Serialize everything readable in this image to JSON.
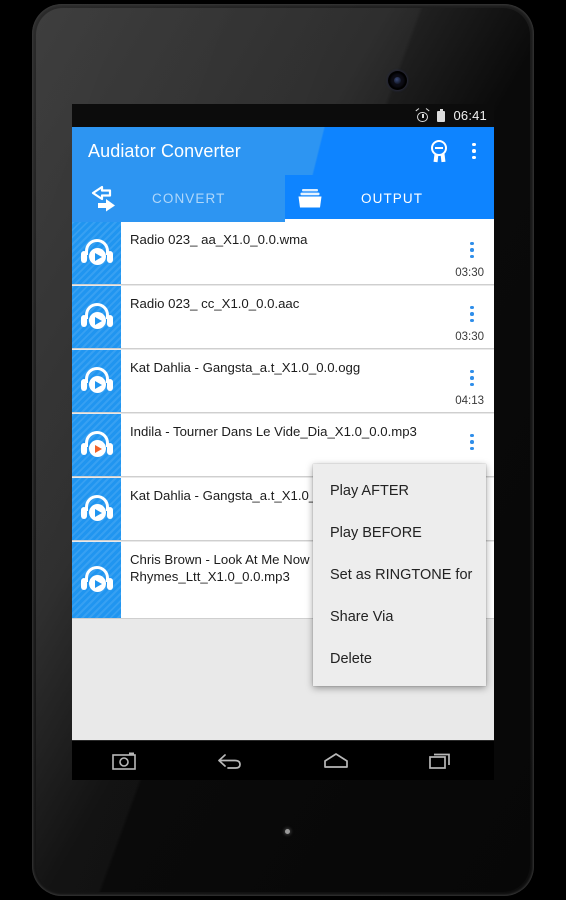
{
  "status_bar": {
    "alarm_icon": "alarm-clock-icon",
    "battery_icon": "battery-icon",
    "time": "06:41"
  },
  "app_bar": {
    "title": "Audiator Converter",
    "award_icon": "award-badge-icon",
    "overflow_icon": "overflow-menu-icon"
  },
  "tabs": [
    {
      "label": "CONVERT",
      "icon": "convert-arrows-icon",
      "active": false
    },
    {
      "label": "OUTPUT",
      "icon": "folder-icon",
      "active": true
    }
  ],
  "list": {
    "items": [
      {
        "title": "Radio 023_ aa_X1.0_0.0.wma",
        "duration": "03:30",
        "icon": "headphones-play-icon",
        "playing": false
      },
      {
        "title": "Radio 023_ cc_X1.0_0.0.aac",
        "duration": "03:30",
        "icon": "headphones-play-icon",
        "playing": false
      },
      {
        "title": "Kat Dahlia - Gangsta_a.t_X1.0_0.0.ogg",
        "duration": "04:13",
        "icon": "headphones-play-icon",
        "playing": false
      },
      {
        "title": "Indila - Tourner Dans Le Vide_Dia_X1.0_0.0.mp3",
        "duration": "",
        "icon": "headphones-play-icon",
        "playing": true
      },
      {
        "title": "Kat Dahlia - Gangsta_a.t_X1.0_0.0.",
        "duration": "",
        "icon": "headphones-play-icon",
        "playing": false
      },
      {
        "title": "Chris Brown - Look At Me Now ft. L Rhymes_Ltt_X1.0_0.0.mp3",
        "duration": "",
        "icon": "headphones-play-icon",
        "playing": false
      }
    ]
  },
  "context_menu": {
    "items": [
      {
        "label": "Play AFTER"
      },
      {
        "label": "Play BEFORE"
      },
      {
        "label": "Set as RINGTONE for"
      },
      {
        "label": "Share Via"
      },
      {
        "label": "Delete"
      }
    ]
  },
  "nav_bar": {
    "buttons": [
      {
        "icon": "screenshot-camera-icon"
      },
      {
        "icon": "back-icon"
      },
      {
        "icon": "home-icon"
      },
      {
        "icon": "recents-icon"
      }
    ]
  },
  "colors": {
    "accent_blue": "#0e84ff",
    "appbar_blue": "#2d95f2",
    "thumb_blue": "#2095f0",
    "playing_orange": "#f2622a",
    "menu_bg": "#ededed"
  }
}
